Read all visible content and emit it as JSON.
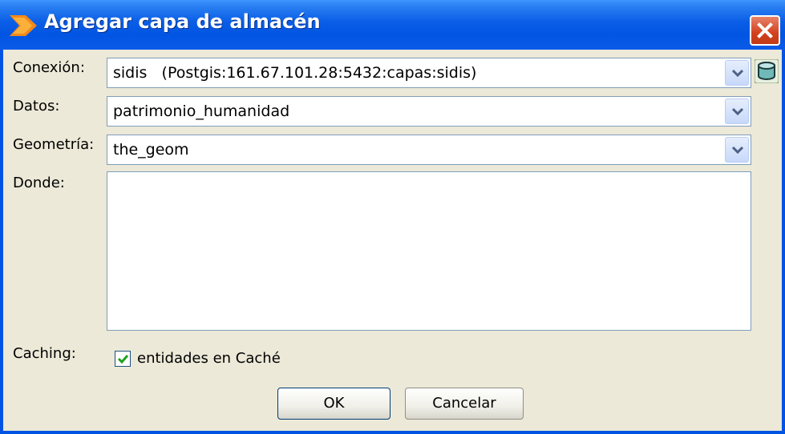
{
  "window": {
    "title": "Agregar capa de almacén"
  },
  "form": {
    "connection": {
      "label": "Conexión:",
      "value": "sidis   (Postgis:161.67.101.28:5432:capas:sidis)"
    },
    "data": {
      "label": "Datos:",
      "value": "patrimonio_humanidad"
    },
    "geometry": {
      "label": "Geometría:",
      "value": "the_geom"
    },
    "where": {
      "label": "Donde:",
      "value": ""
    },
    "caching": {
      "label": "Caching:",
      "checkbox_label": "entidades en Caché",
      "checked": true
    }
  },
  "buttons": {
    "ok": "OK",
    "cancel": "Cancelar"
  },
  "icons": {
    "app": "layer-arrow-icon",
    "connection_manager": "database-icon",
    "close": "close-icon",
    "dropdown": "chevron-down-icon",
    "check": "checkmark-icon"
  }
}
